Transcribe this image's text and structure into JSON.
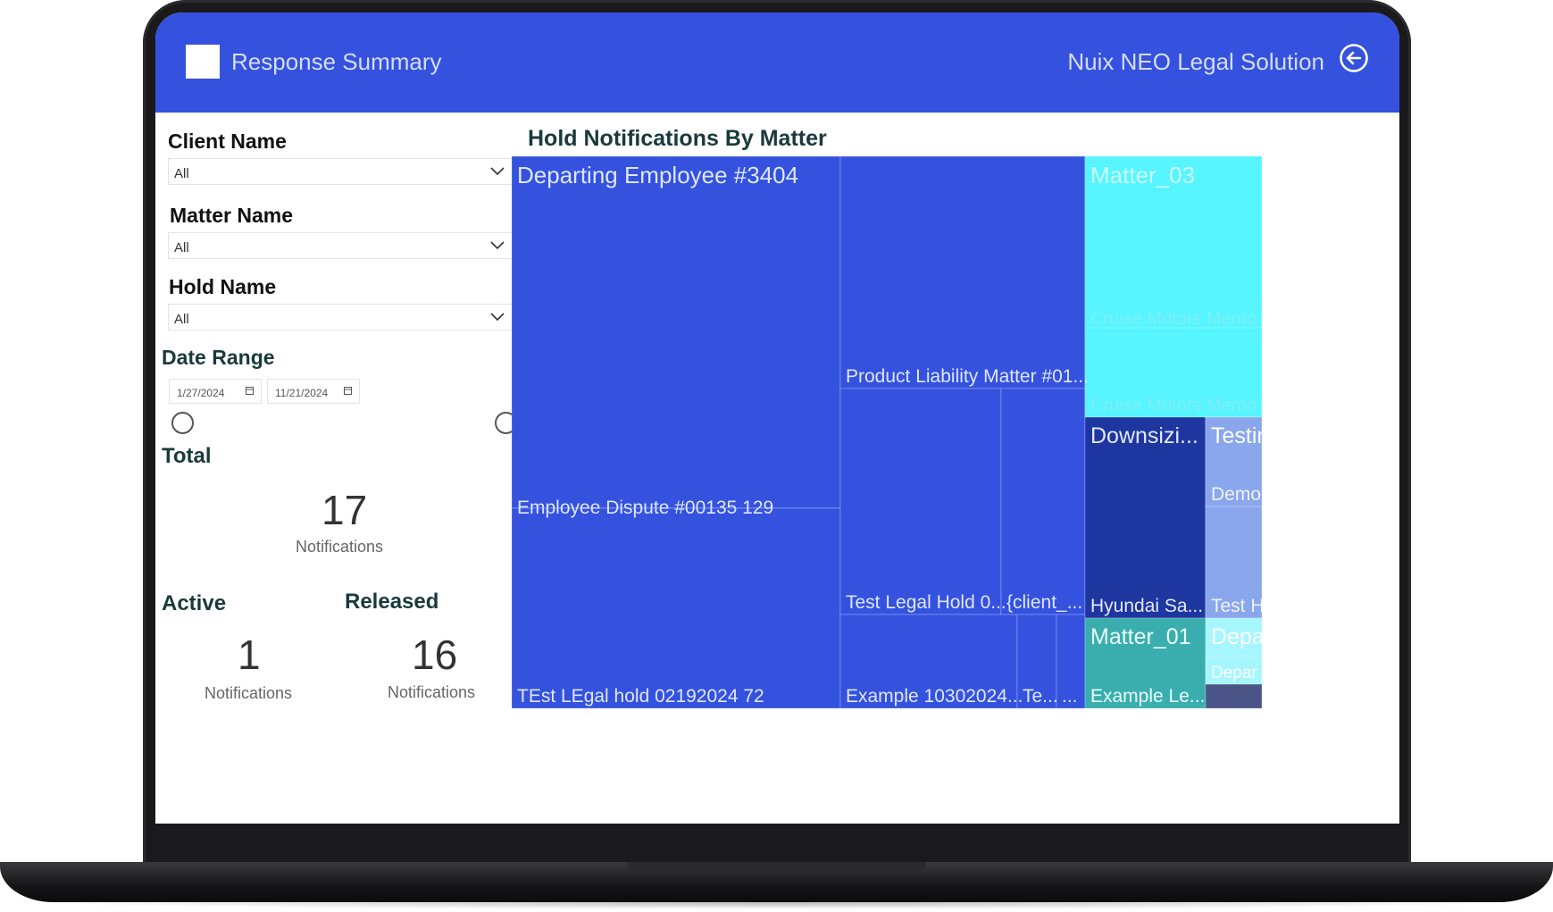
{
  "header": {
    "title": "Response Summary",
    "brand": "Nuix NEO Legal Solution",
    "back_icon": "back-arrow-circle-icon",
    "bg_color": "#3452de"
  },
  "filters": {
    "client_label": "Client Name",
    "client_value": "All",
    "matter_label": "Matter Name",
    "matter_value": "All",
    "hold_label": "Hold Name",
    "hold_value": "All",
    "date_label": "Date Range",
    "date_start": "1/27/2024",
    "date_end": "11/21/2024"
  },
  "totals": {
    "total_label": "Total",
    "total_value": "17",
    "total_caption": "Notifications",
    "active_label": "Active",
    "active_value": "1",
    "active_caption": "Notifications",
    "released_label": "Released",
    "released_value": "16",
    "released_caption": "Notifications"
  },
  "chart_data": {
    "type": "treemap",
    "title": "Hold Notifications By Matter",
    "labels": [
      "Departing Employee #3404",
      "Employee Dispute #00135 129",
      "TEst LEgal hold 02192024 72",
      "Product Liability Matter #01...",
      "Test Legal Hold 0...",
      "{client_...",
      "Example 10302024...",
      "Te...",
      "...",
      "Matter_03",
      "Cruise Motors Memo",
      "Cruise Motors Memo",
      "Downsizi...",
      "Hyundai Sa...",
      "Testin",
      "Demo",
      "Test H",
      "Matter_01",
      "Example Le...",
      "Depa",
      "Depar"
    ],
    "colors": [
      "#3452de",
      "#1e36a0",
      "#56f5ff",
      "#8aa6ec",
      "#3aaeae",
      "#a6f6ff",
      "#4a5487"
    ]
  }
}
